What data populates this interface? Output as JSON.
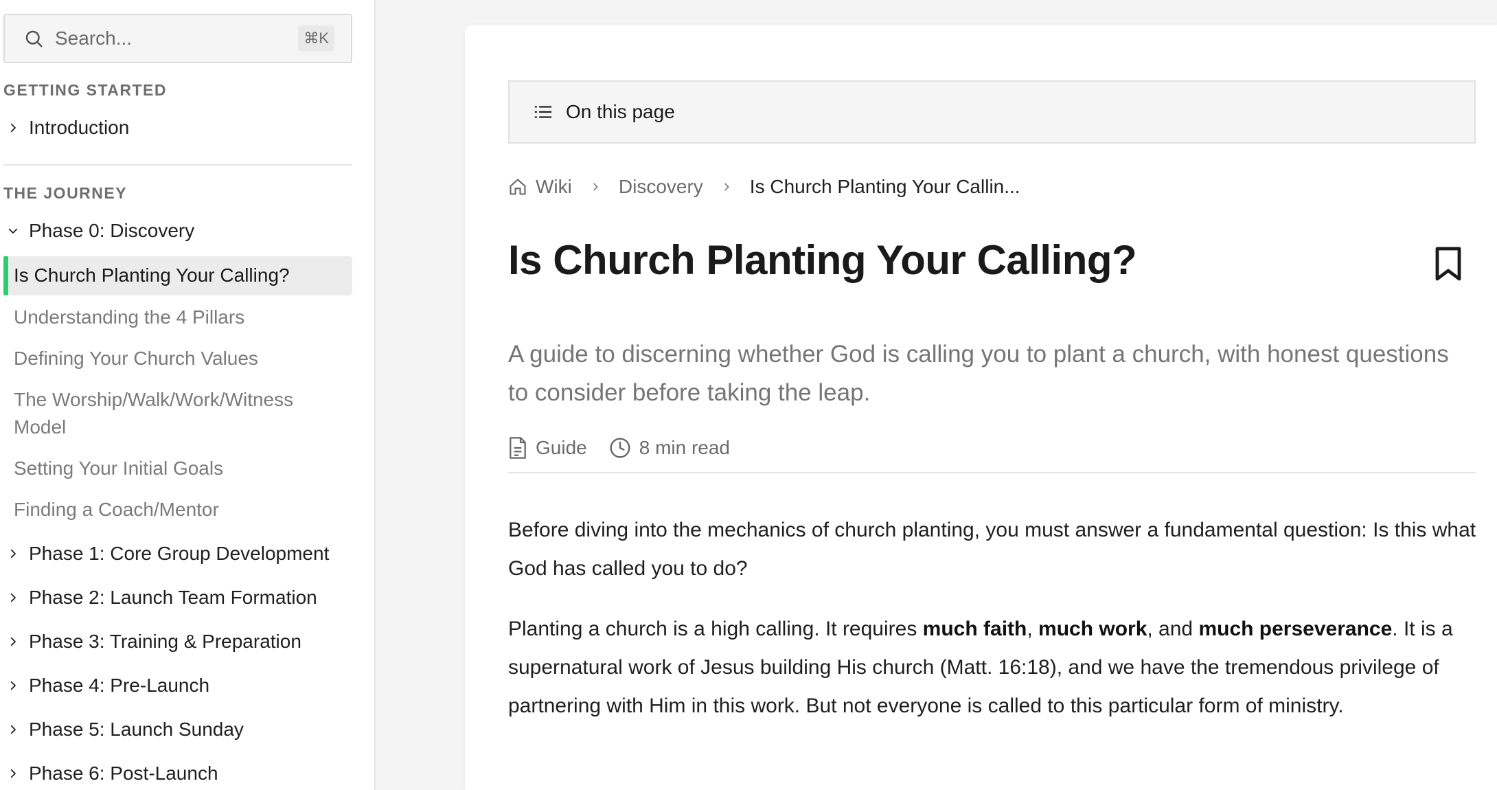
{
  "search": {
    "placeholder": "Search...",
    "shortcut": "⌘K"
  },
  "sidebar": {
    "getting_started": {
      "heading": "GETTING STARTED",
      "items": [
        {
          "label": "Introduction",
          "expanded": false
        }
      ]
    },
    "journey": {
      "heading": "THE JOURNEY",
      "phase0": {
        "label": "Phase 0: Discovery",
        "expanded": true,
        "children": [
          {
            "label": "Is Church Planting Your Calling?",
            "active": true
          },
          {
            "label": "Understanding the 4 Pillars"
          },
          {
            "label": "Defining Your Church Values"
          },
          {
            "label": "The Worship/Walk/Work/Witness Model"
          },
          {
            "label": "Setting Your Initial Goals"
          },
          {
            "label": "Finding a Coach/Mentor"
          }
        ]
      },
      "phases": [
        {
          "label": "Phase 1: Core Group Development"
        },
        {
          "label": "Phase 2: Launch Team Formation"
        },
        {
          "label": "Phase 3: Training & Preparation"
        },
        {
          "label": "Phase 4: Pre-Launch"
        },
        {
          "label": "Phase 5: Launch Sunday"
        },
        {
          "label": "Phase 6: Post-Launch"
        }
      ]
    },
    "active_color": "#2ecc71"
  },
  "toc": {
    "label": "On this page"
  },
  "breadcrumb": [
    "Wiki",
    "Discovery",
    "Is Church Planting Your Callin..."
  ],
  "article": {
    "title": "Is Church Planting Your Calling?",
    "lead": "A guide to discerning whether God is calling you to plant a church, with honest questions to consider before taking the leap.",
    "meta": {
      "type": "Guide",
      "read_time": "8 min read"
    },
    "p1": "Before diving into the mechanics of church planting, you must answer a fundamental question: Is this what God has called you to do?",
    "p2": {
      "a": "Planting a church is a high calling. It requires ",
      "b1": "much faith",
      "c": ", ",
      "b2": "much work",
      "d": ", and ",
      "b3": "much perseverance",
      "e": ". It is a supernatural work of Jesus building His church (Matt. 16:18), and we have the tremendous privilege of partnering with Him in this work. But not everyone is called to this particular form of ministry."
    }
  }
}
